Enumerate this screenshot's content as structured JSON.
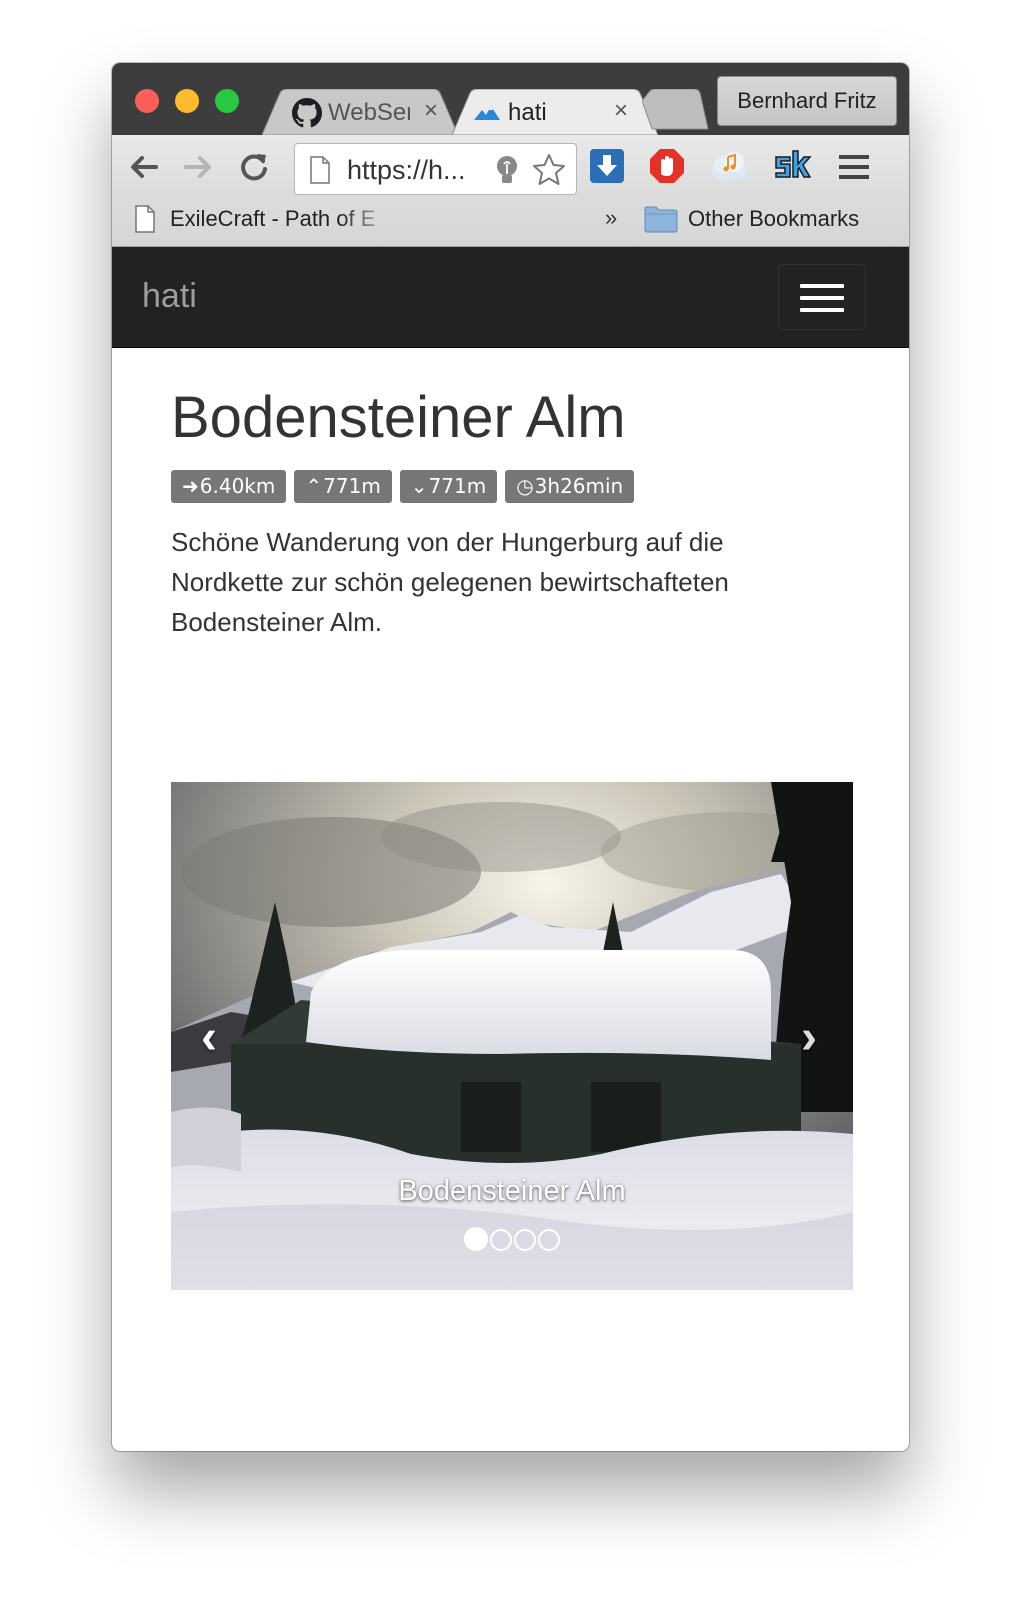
{
  "browser": {
    "tabs": [
      {
        "title": "WebSer",
        "close": "×",
        "favicon": "github-icon"
      },
      {
        "title": "hati",
        "close": "×",
        "favicon": "mountain-icon"
      }
    ],
    "profile": "Bernhard Fritz",
    "address": "https://h...",
    "bookmarks": {
      "first": "ExileCraft - Path of E",
      "overflow": "»",
      "other": "Other Bookmarks"
    }
  },
  "page": {
    "brand": "hati",
    "title": "Bodensteiner Alm",
    "badges": [
      {
        "icon": "arrow-right-icon",
        "glyph": "➜",
        "value": "6.40km"
      },
      {
        "icon": "chevron-up-icon",
        "glyph": "⌃",
        "value": "771m"
      },
      {
        "icon": "chevron-down-icon",
        "glyph": "⌄",
        "value": "771m"
      },
      {
        "icon": "clock-icon",
        "glyph": "◷",
        "value": "3h26min"
      }
    ],
    "description": "Schöne Wanderung von der Hungerburg auf die Nordkette zur schön gelegenen bewirtschafteten Bodensteiner Alm.",
    "carousel": {
      "caption": "Bodensteiner Alm",
      "prev": "‹",
      "next": "›",
      "slides": 4,
      "active_slide": 1
    }
  }
}
